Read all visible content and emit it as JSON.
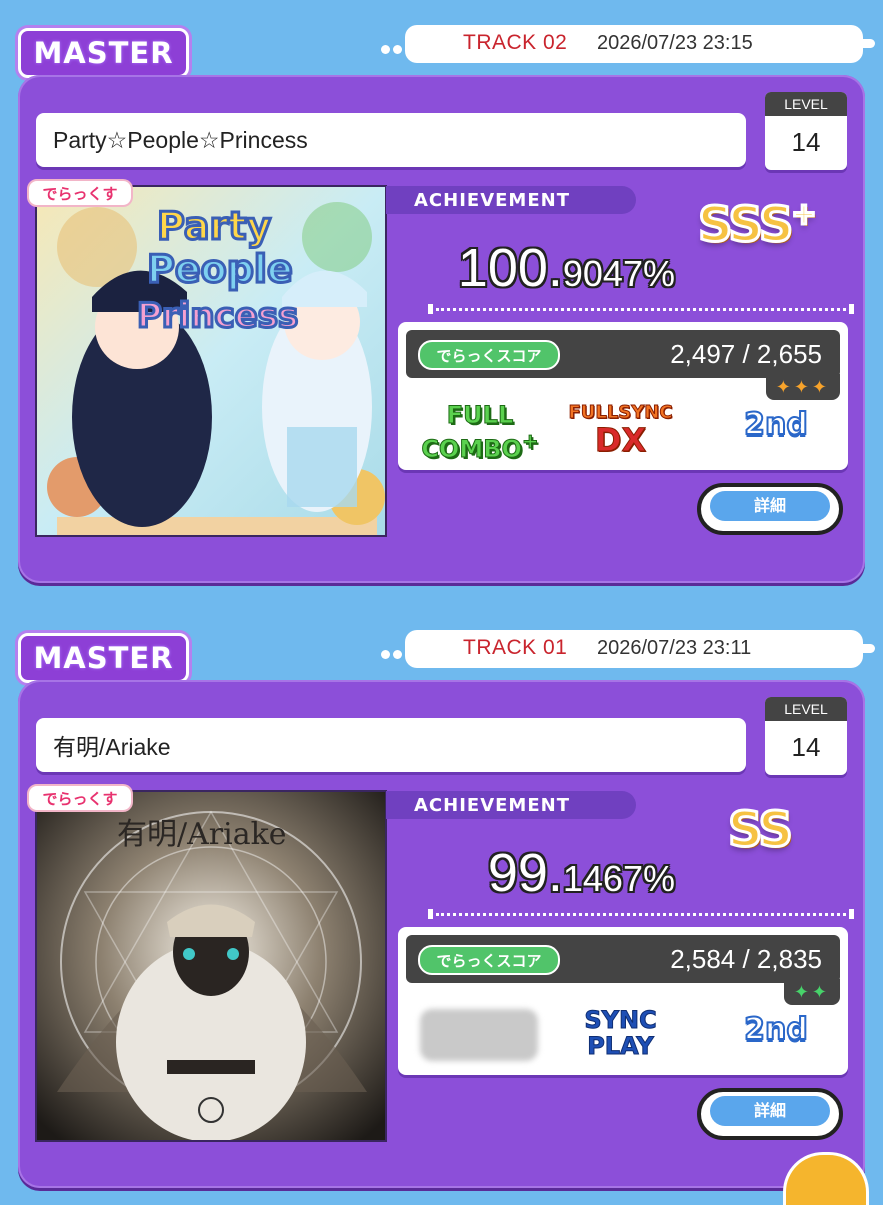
{
  "records": [
    {
      "difficulty": "MASTER",
      "track_label": "TRACK 02",
      "datetime": "2026/07/23 23:15",
      "title": "Party☆People☆Princess",
      "level_label": "LEVEL",
      "level": "14",
      "deluxe_badge": "でらっくす",
      "achievement_label": "ACHIEVEMENT",
      "rank": "SSS",
      "rank_plus": "+",
      "achievement_int": "100.",
      "achievement_dec": "9047%",
      "score_tag": "でらっくスコア",
      "dx_score": "2,497 / 2,655",
      "dx_stars": "✦✦✦",
      "combo_line1": "FULL",
      "combo_line2": "COMBO",
      "combo_plus": "+",
      "sync_line1": "FULLSYNC",
      "sync_line2": "DX",
      "place": "2nd",
      "detail_button": "詳細",
      "jacket_text": [
        "Party",
        "People",
        "Princess"
      ]
    },
    {
      "difficulty": "MASTER",
      "track_label": "TRACK 01",
      "datetime": "2026/07/23 23:11",
      "title": "有明/Ariake",
      "level_label": "LEVEL",
      "level": "14",
      "deluxe_badge": "でらっくす",
      "achievement_label": "ACHIEVEMENT",
      "rank": "SS",
      "achievement_int": "99.",
      "achievement_dec": "1467%",
      "score_tag": "でらっくスコア",
      "dx_score": "2,584 / 2,835",
      "dx_stars": "✦✦",
      "sync_line1": "SYNC",
      "sync_line2": "PLAY",
      "place": "2nd",
      "detail_button": "詳細",
      "jacket_text": "有明/Ariake"
    }
  ],
  "colors": {
    "background": "#6fb9ee",
    "panel": "#8c4fd9",
    "track_red": "#c9242d"
  }
}
